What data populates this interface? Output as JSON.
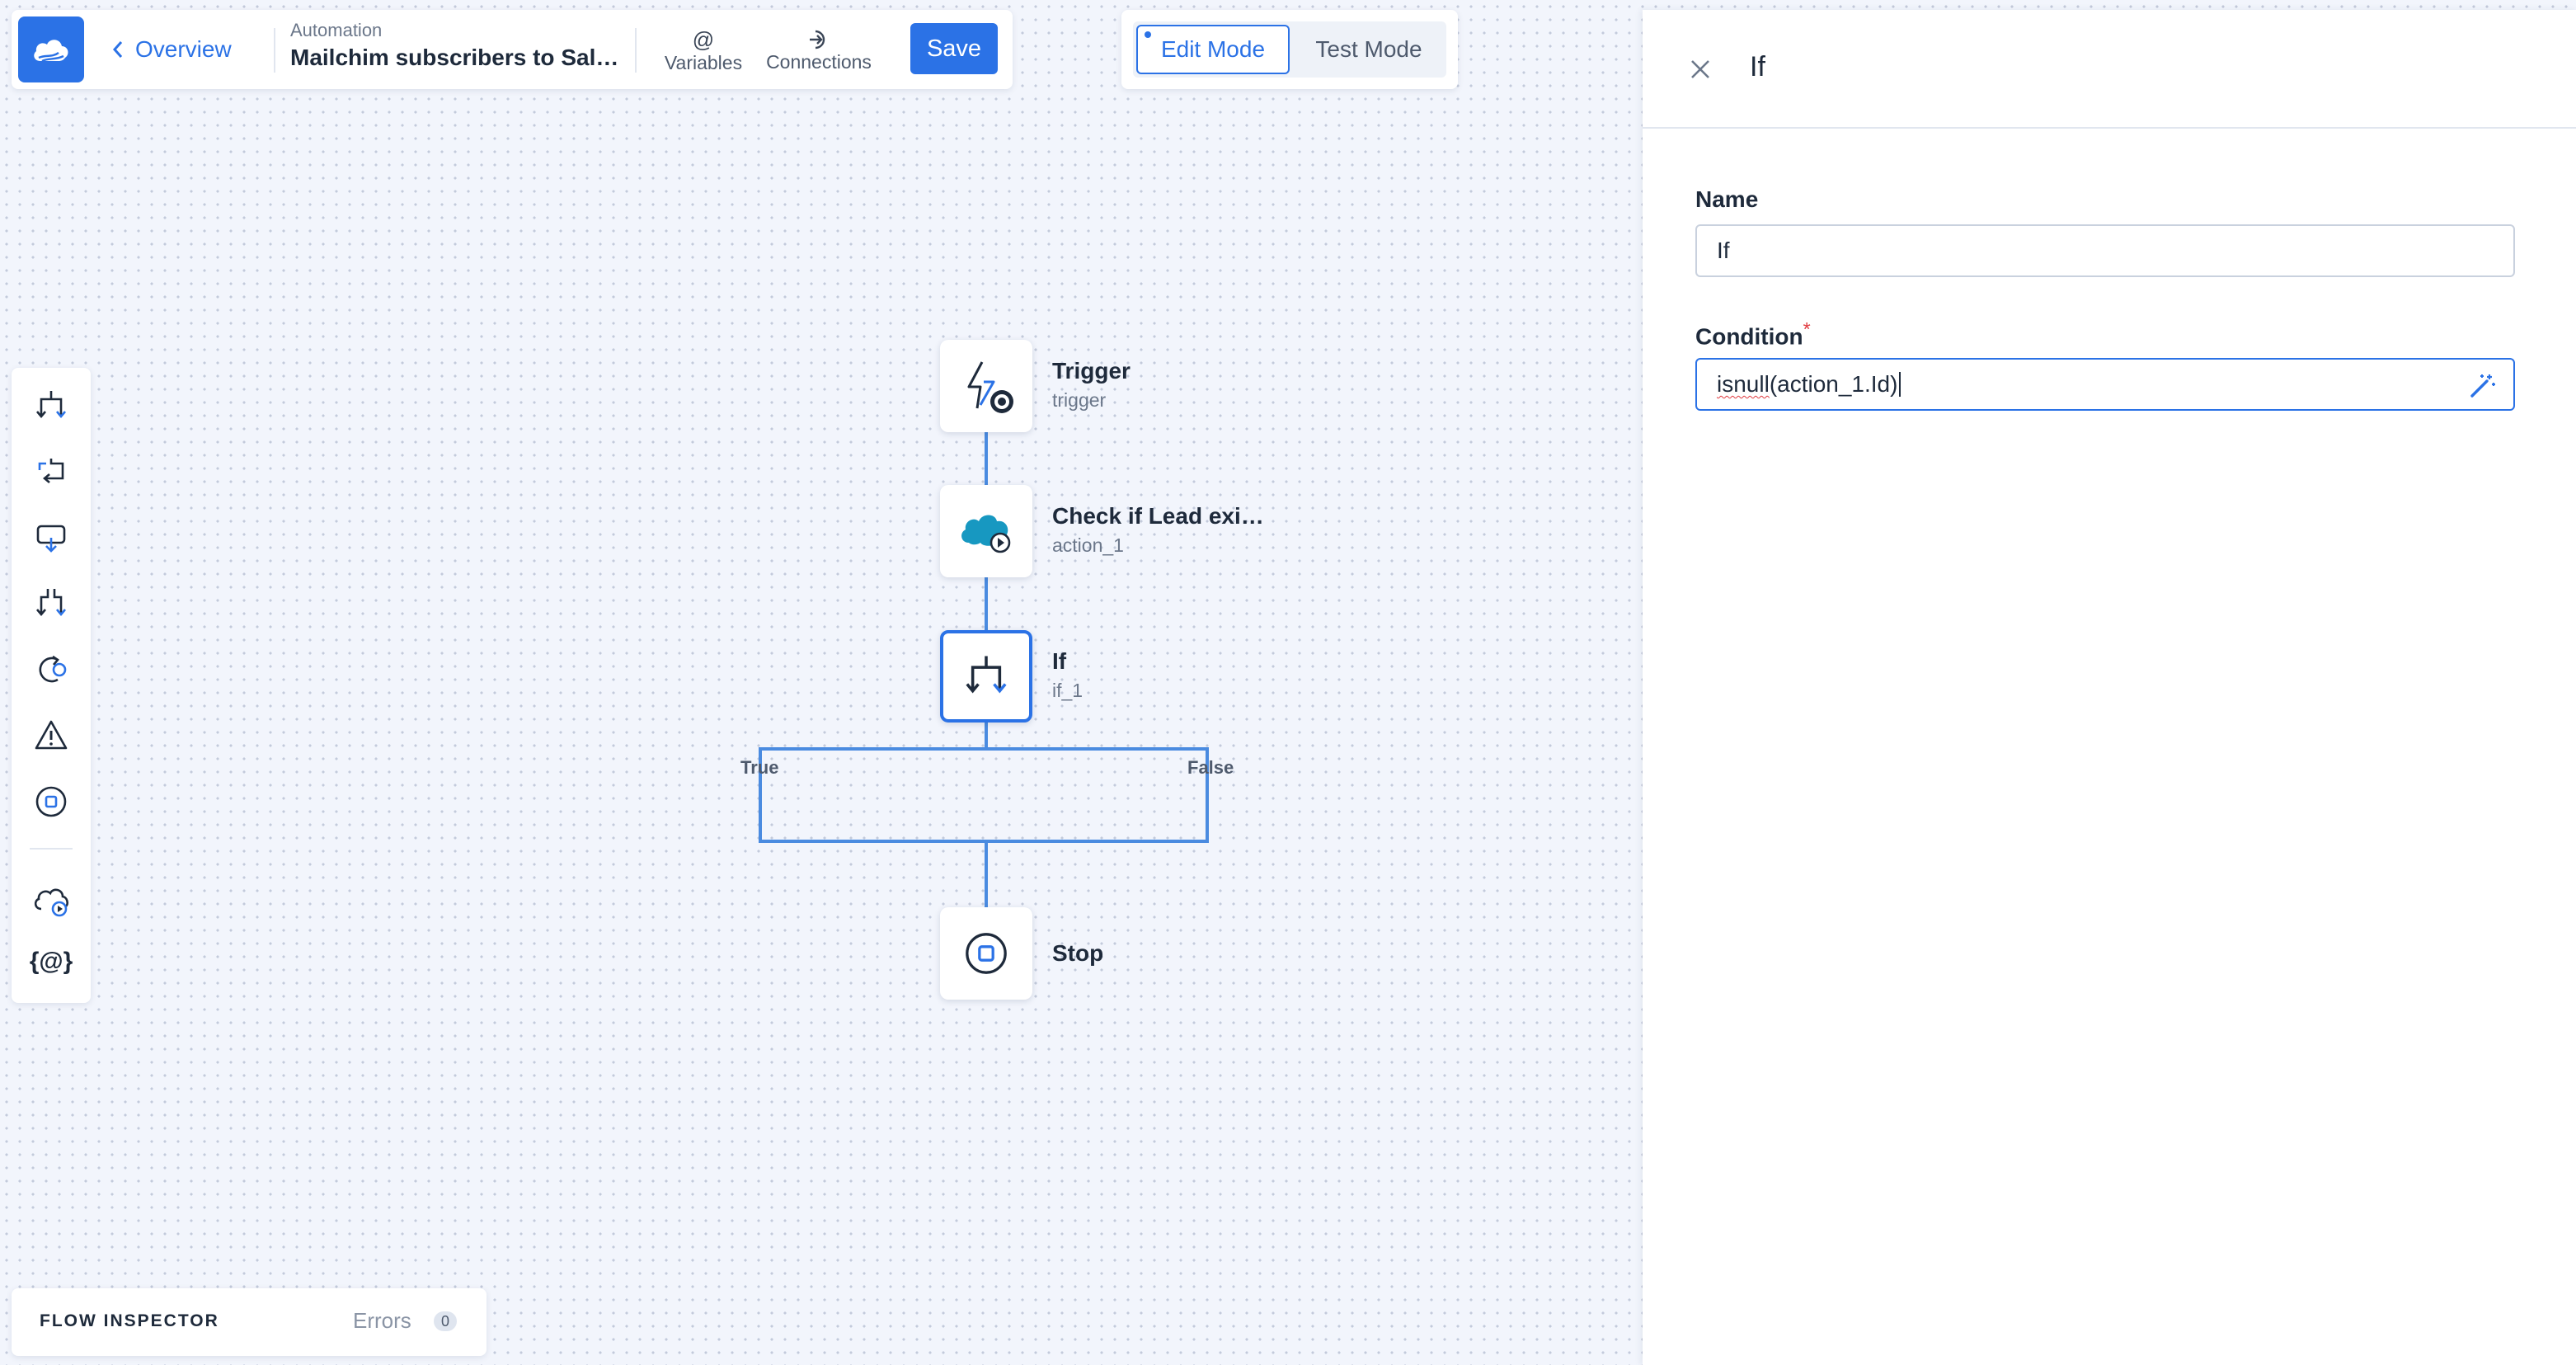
{
  "header": {
    "back_label": "Overview",
    "section_label": "Automation",
    "automation_name": "Mailchim subscribers to Salesf…",
    "variables_label": "Variables",
    "connections_label": "Connections",
    "save_label": "Save"
  },
  "mode": {
    "edit_label": "Edit Mode",
    "test_label": "Test Mode",
    "active": "edit"
  },
  "toolbox": {
    "items": [
      "if-icon",
      "loop-icon",
      "wait-icon",
      "parallel-icon",
      "retry-icon",
      "warning-icon",
      "stop-icon",
      "cloud-action-icon",
      "variables-icon"
    ],
    "variables_glyph": "{@}"
  },
  "flow": {
    "nodes": [
      {
        "title": "Trigger",
        "subtitle": "trigger"
      },
      {
        "title": "Check if Lead exi…",
        "subtitle": "action_1"
      },
      {
        "title": "If",
        "subtitle": "if_1"
      },
      {
        "title": "Stop",
        "subtitle": ""
      }
    ],
    "branch_true": "True",
    "branch_false": "False"
  },
  "inspector": {
    "title": "FLOW INSPECTOR",
    "errors_label": "Errors",
    "errors_count": "0"
  },
  "panel": {
    "title": "If",
    "name_label": "Name",
    "name_value": "If",
    "condition_label": "Condition",
    "required_mark": "*",
    "condition_value": "isnull(action_1.Id)",
    "condition_func": "isnull",
    "condition_args": "(action_1.Id)"
  },
  "colors": {
    "accent": "#2b72e6",
    "connector": "#4a8be0",
    "required": "#e0393e"
  }
}
